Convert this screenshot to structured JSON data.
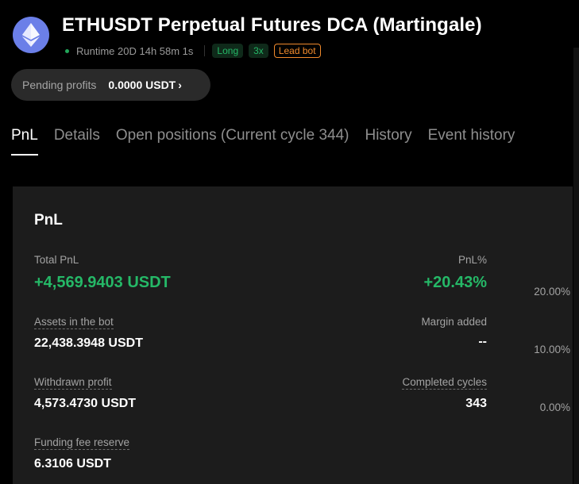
{
  "header": {
    "title": "ETHUSDT Perpetual Futures DCA (Martingale)",
    "runtime": "Runtime 20D 14h 58m 1s",
    "tags": [
      "Long",
      "3x",
      "Lead bot"
    ]
  },
  "pending_profits": {
    "label": "Pending profits",
    "value": "0.0000 USDT",
    "chevron": "›"
  },
  "tabs": [
    {
      "label": "PnL"
    },
    {
      "label": "Details"
    },
    {
      "label": "Open positions (Current cycle 344)"
    },
    {
      "label": "History"
    },
    {
      "label": "Event history"
    }
  ],
  "pnl": {
    "title": "PnL",
    "total_pnl_label": "Total PnL",
    "total_pnl_value": "+4,569.9403 USDT",
    "pnl_pct_label": "PnL%",
    "pnl_pct_value": "+20.43%",
    "assets_label": "Assets in the bot",
    "assets_value": "22,438.3948 USDT",
    "margin_label": "Margin added",
    "margin_value": "--",
    "withdrawn_label": "Withdrawn profit",
    "withdrawn_value": "4,573.4730 USDT",
    "cycles_label": "Completed cycles",
    "cycles_value": "343",
    "funding_label": "Funding fee reserve",
    "funding_value": "6.3106 USDT"
  },
  "chart_axis": {
    "ticks": [
      "20.00%",
      "10.00%",
      "0.00%"
    ]
  },
  "colors": {
    "positive": "#25b867",
    "lead_tag": "#f08a2c",
    "coin": "#6b7fe8"
  },
  "icons": {
    "coin": "ethereum-icon"
  }
}
